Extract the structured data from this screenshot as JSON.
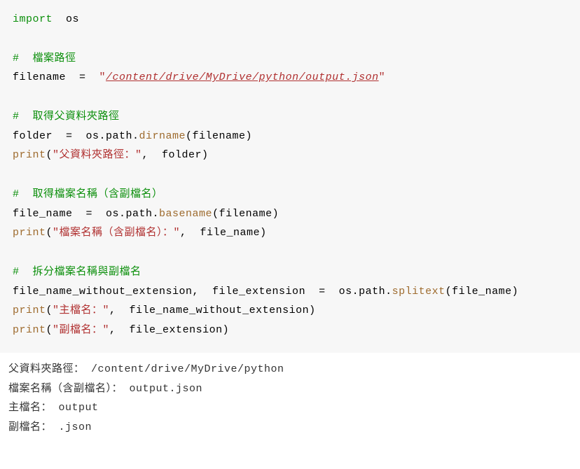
{
  "code": {
    "import": "import",
    "os": "os",
    "c1": "#  檔案路徑",
    "l2a": "filename  =  ",
    "l2q1": "\"",
    "l2path": "/content/drive/MyDrive/python/output.json",
    "l2q2": "\"",
    "c2": "#  取得父資料夾路徑",
    "l4": "folder  =  os.path.",
    "l4fn": "dirname",
    "l4b": "(filename)",
    "l5a": "print",
    "l5b": "(",
    "l5str": "\"父資料夾路徑：\"",
    "l5c": ",  folder)",
    "c3": "#  取得檔案名稱（含副檔名）",
    "l7": "file_name  =  os.path.",
    "l7fn": "basename",
    "l7b": "(filename)",
    "l8a": "print",
    "l8b": "(",
    "l8str": "\"檔案名稱（含副檔名）：\"",
    "l8c": ",  file_name)",
    "c4": "#  拆分檔案名稱與副檔名",
    "l10": "file_name_without_extension,  file_extension  =  os.path.",
    "l10fn": "splitext",
    "l10b": "(file_name)",
    "l11a": "print",
    "l11b": "(",
    "l11str": "\"主檔名：\"",
    "l11c": ",  file_name_without_extension)",
    "l12a": "print",
    "l12b": "(",
    "l12str": "\"副檔名：\"",
    "l12c": ",  file_extension)"
  },
  "output": {
    "l1": "父資料夾路徑： /content/drive/MyDrive/python",
    "l2": "檔案名稱（含副檔名）： output.json",
    "l3": "主檔名： output",
    "l4": "副檔名： .json"
  }
}
